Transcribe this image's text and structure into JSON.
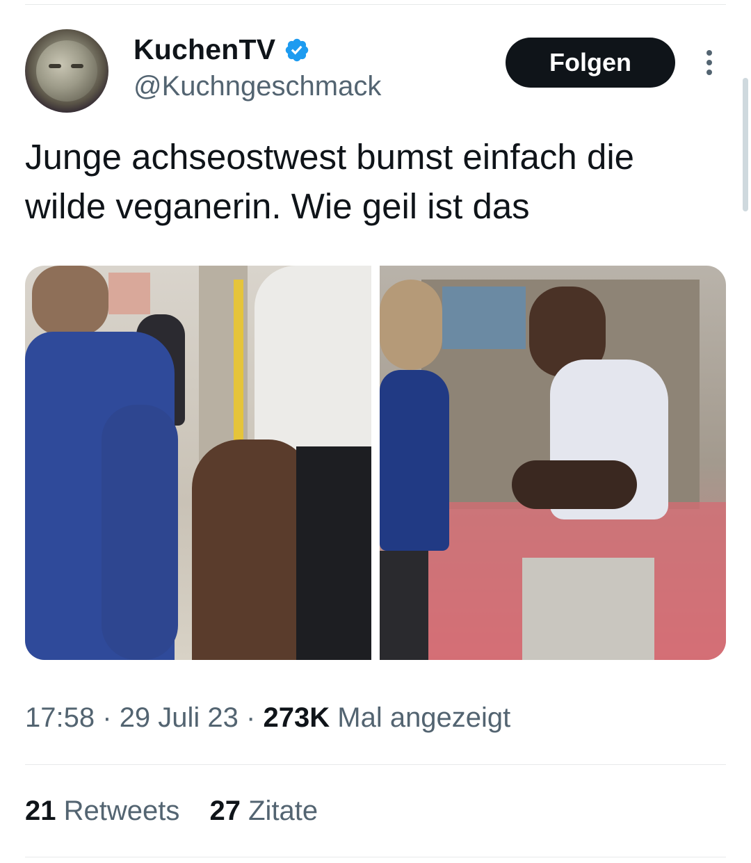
{
  "tweet": {
    "author": {
      "display_name": "KuchenTV",
      "handle": "@Kuchngeschmack",
      "verified": true,
      "verified_color": "#1d9bf0"
    },
    "follow_label": "Folgen",
    "text": "Junge achseostwest bumst einfach die wilde veganerin. Wie geil ist das",
    "media": [
      {
        "name": "photo-1"
      },
      {
        "name": "photo-2"
      }
    ],
    "meta": {
      "time": "17:58",
      "separator": "·",
      "date": "29 Juli 23",
      "views_count": "273K",
      "views_label": "Mal angezeigt"
    },
    "stats": {
      "retweets_count": "21",
      "retweets_label": "Retweets",
      "quotes_count": "27",
      "quotes_label": "Zitate"
    }
  },
  "colors": {
    "text_primary": "#0f1419",
    "text_secondary": "#536471",
    "button_bg": "#0f1419",
    "divider": "#e7e9ea"
  },
  "icons": [
    "verified-badge-icon",
    "more-options-icon"
  ]
}
